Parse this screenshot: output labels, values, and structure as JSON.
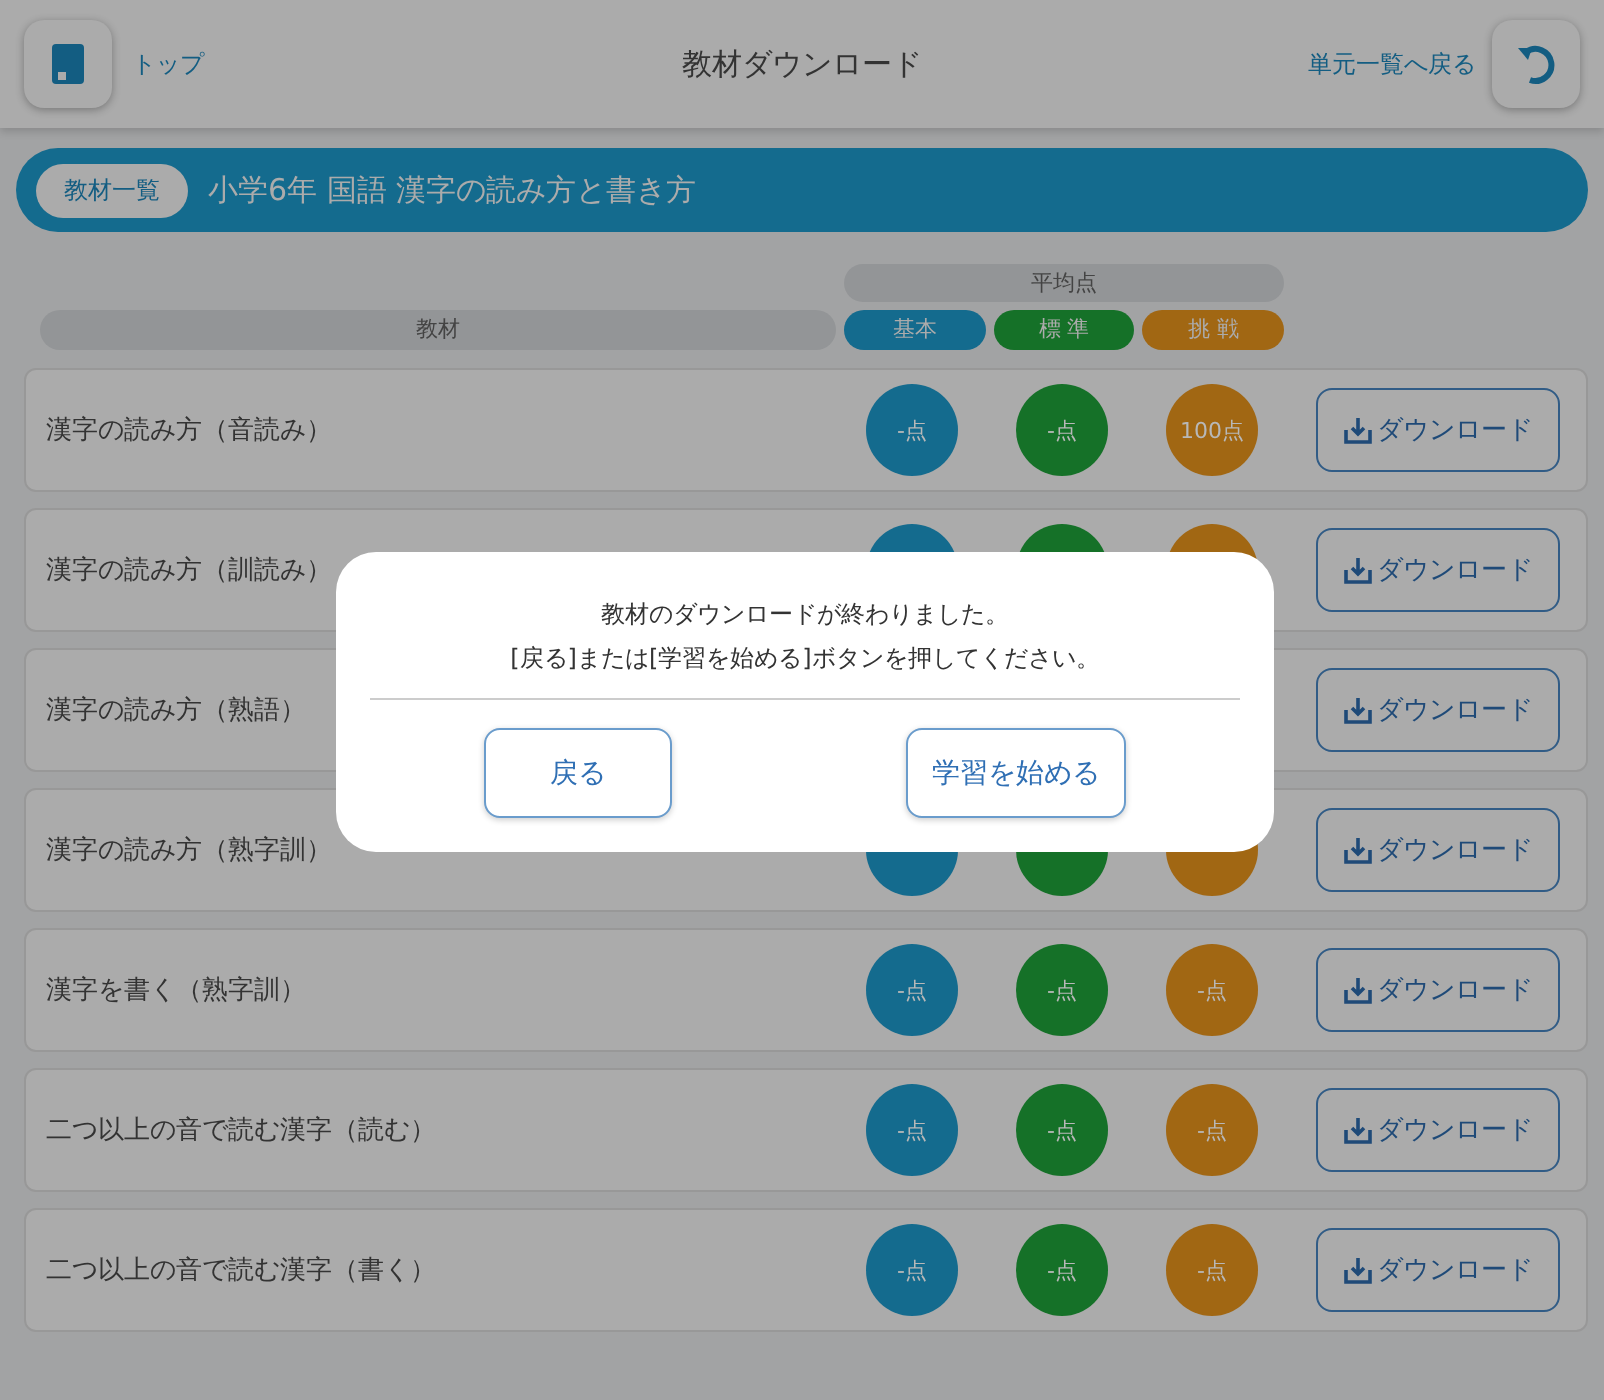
{
  "header": {
    "home_label": "トップ",
    "title": "教材ダウンロード",
    "back_link": "単元一覧へ戻る"
  },
  "banner": {
    "badge": "教材一覧",
    "title": "小学6年 国語 漢字の読み方と書き方"
  },
  "columns": {
    "material": "教材",
    "average": "平均点",
    "levels": [
      {
        "label": "基本",
        "color": "#146b8e"
      },
      {
        "label": "標 準",
        "color": "#157128"
      },
      {
        "label": "挑 戦",
        "color": "#a16713"
      }
    ]
  },
  "rows": [
    {
      "title": "漢字の読み方（音読み）",
      "scores": [
        "-点",
        "-点",
        "100点"
      ],
      "button": "ダウンロード"
    },
    {
      "title": "漢字の読み方（訓読み）",
      "button": "ダウンロード"
    },
    {
      "title": "漢字の読み方（熟語）",
      "button": "ダウンロード"
    },
    {
      "title": "漢字の読み方（熟字訓）",
      "button": "ダウンロード"
    },
    {
      "title": "漢字を書く（熟字訓）",
      "scores": [
        "-点",
        "-点",
        "-点"
      ],
      "button": "ダウンロード"
    },
    {
      "title": "二つ以上の音で読む漢字（読む）",
      "scores": [
        "-点",
        "-点",
        "-点"
      ],
      "button": "ダウンロード"
    },
    {
      "title": "二つ以上の音で読む漢字（書く）",
      "scores": [
        "-点",
        "-点",
        "-点"
      ],
      "button": "ダウンロード"
    }
  ],
  "dialog": {
    "message": [
      "教材のダウンロードが終わりました。",
      "[戻る]または[学習を始める]ボタンを押してください。"
    ],
    "buttons": [
      {
        "label": "戻る"
      },
      {
        "label": "学習を始める"
      }
    ]
  }
}
